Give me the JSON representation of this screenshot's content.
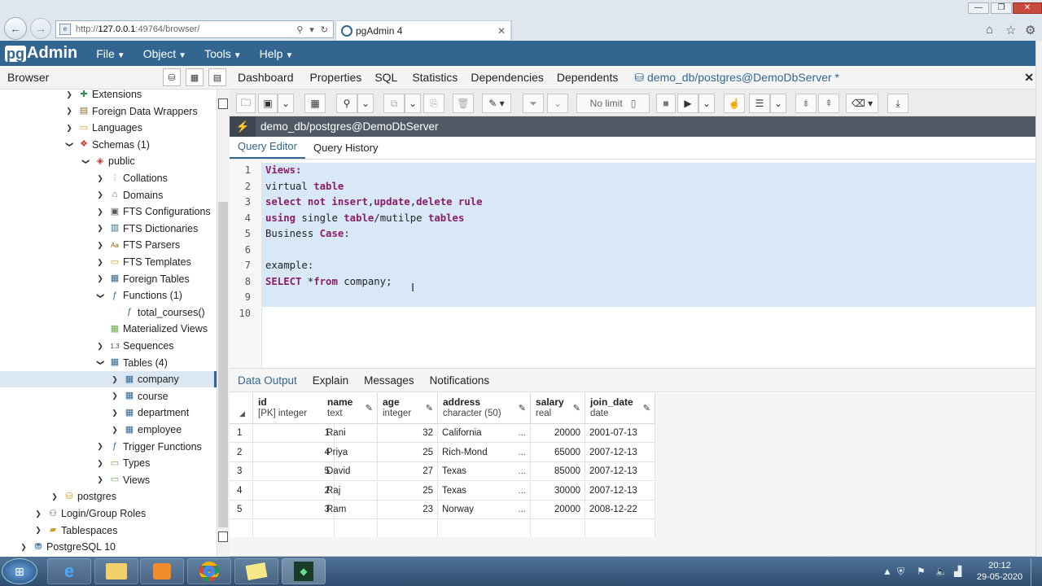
{
  "browser": {
    "url": "http://127.0.0.1:49764/browser/",
    "url_prefix": "http://",
    "url_host": "127.0.0.1",
    "url_rest": ":49764/browser/",
    "tab_title": "pgAdmin 4"
  },
  "app": {
    "logo_pg": "pg",
    "logo_rest": "Admin",
    "menus": [
      "File",
      "Object",
      "Tools",
      "Help"
    ]
  },
  "browser_panel": {
    "title": "Browser"
  },
  "tree": [
    {
      "label": "Extensions",
      "depth": 4,
      "arrow": "›",
      "icon": "puzzle-icon"
    },
    {
      "label": "Foreign Data Wrappers",
      "depth": 4,
      "arrow": "›",
      "icon": "fdw-icon"
    },
    {
      "label": "Languages",
      "depth": 4,
      "arrow": "›",
      "icon": "language-icon"
    },
    {
      "label": "Schemas (1)",
      "depth": 4,
      "arrow": "⌄",
      "icon": "schema-icon"
    },
    {
      "label": "public",
      "depth": 5,
      "arrow": "⌄",
      "icon": "schema-public-icon"
    },
    {
      "label": "Collations",
      "depth": 6,
      "arrow": "›",
      "icon": "collation-icon"
    },
    {
      "label": "Domains",
      "depth": 6,
      "arrow": "›",
      "icon": "domain-icon"
    },
    {
      "label": "FTS Configurations",
      "depth": 6,
      "arrow": "›",
      "icon": "fts-config-icon"
    },
    {
      "label": "FTS Dictionaries",
      "depth": 6,
      "arrow": "›",
      "icon": "fts-dictionary-icon"
    },
    {
      "label": "FTS Parsers",
      "depth": 6,
      "arrow": "›",
      "icon": "fts-parser-icon"
    },
    {
      "label": "FTS Templates",
      "depth": 6,
      "arrow": "›",
      "icon": "fts-template-icon"
    },
    {
      "label": "Foreign Tables",
      "depth": 6,
      "arrow": "›",
      "icon": "foreign-table-icon"
    },
    {
      "label": "Functions (1)",
      "depth": 6,
      "arrow": "⌄",
      "icon": "function-icon"
    },
    {
      "label": "total_courses()",
      "depth": 7,
      "arrow": "",
      "icon": "function-icon"
    },
    {
      "label": "Materialized Views",
      "depth": 6,
      "arrow": "",
      "icon": "materialized-view-icon"
    },
    {
      "label": "Sequences",
      "depth": 6,
      "arrow": "›",
      "icon": "sequence-icon"
    },
    {
      "label": "Tables (4)",
      "depth": 6,
      "arrow": "⌄",
      "icon": "table-icon"
    },
    {
      "label": "company",
      "depth": 7,
      "arrow": "›",
      "icon": "table-icon",
      "selected": true
    },
    {
      "label": "course",
      "depth": 7,
      "arrow": "›",
      "icon": "table-icon"
    },
    {
      "label": "department",
      "depth": 7,
      "arrow": "›",
      "icon": "table-icon"
    },
    {
      "label": "employee",
      "depth": 7,
      "arrow": "›",
      "icon": "table-icon"
    },
    {
      "label": "Trigger Functions",
      "depth": 6,
      "arrow": "›",
      "icon": "trigger-function-icon"
    },
    {
      "label": "Types",
      "depth": 6,
      "arrow": "›",
      "icon": "type-icon"
    },
    {
      "label": "Views",
      "depth": 6,
      "arrow": "›",
      "icon": "view-icon"
    },
    {
      "label": "postgres",
      "depth": 3,
      "arrow": "›",
      "icon": "database-icon"
    },
    {
      "label": "Login/Group Roles",
      "depth": 2,
      "arrow": "›",
      "icon": "roles-icon"
    },
    {
      "label": "Tablespaces",
      "depth": 2,
      "arrow": "›",
      "icon": "tablespace-icon"
    },
    {
      "label": "PostgreSQL 10",
      "depth": 1,
      "arrow": "›",
      "icon": "server-icon"
    }
  ],
  "main_tabs": [
    "Dashboard",
    "Properties",
    "SQL",
    "Statistics",
    "Dependencies",
    "Dependents",
    "demo_db/postgres@DemoDbServer *"
  ],
  "toolbar": {
    "limit": "No limit"
  },
  "connection": {
    "label": "demo_db/postgres@DemoDbServer"
  },
  "query_tabs": [
    "Query Editor",
    "Query History"
  ],
  "editor": {
    "line_numbers": [
      "1",
      "2",
      "3",
      "4",
      "5",
      "6",
      "7",
      "8",
      "9",
      "10"
    ],
    "lines": [
      [
        {
          "t": "Views:",
          "k": true
        }
      ],
      [
        {
          "t": "virtual ",
          "k": false
        },
        {
          "t": "table",
          "k": true
        }
      ],
      [
        {
          "t": "select not insert",
          "k": true
        },
        {
          "t": ",",
          "k": false
        },
        {
          "t": "update",
          "k": true
        },
        {
          "t": ",",
          "k": false
        },
        {
          "t": "delete rule",
          "k": true
        }
      ],
      [
        {
          "t": "using",
          "k": true
        },
        {
          "t": " single ",
          "k": false
        },
        {
          "t": "table",
          "k": true
        },
        {
          "t": "/mutilpe ",
          "k": false
        },
        {
          "t": "tables",
          "k": true
        }
      ],
      [
        {
          "t": "Business ",
          "k": false
        },
        {
          "t": "Case",
          "k": true
        },
        {
          "t": ":",
          "k": false
        }
      ],
      [],
      [
        {
          "t": "example:",
          "k": false
        }
      ],
      [
        {
          "t": "SELECT",
          "k": true
        },
        {
          "t": " *",
          "k": false
        },
        {
          "t": "from",
          "k": true
        },
        {
          "t": " company;",
          "k": false
        }
      ],
      [],
      []
    ]
  },
  "output_tabs": [
    "Data Output",
    "Explain",
    "Messages",
    "Notifications"
  ],
  "grid": {
    "columns": [
      {
        "name": "id",
        "type": "[PK] integer"
      },
      {
        "name": "name",
        "type": "text"
      },
      {
        "name": "age",
        "type": "integer"
      },
      {
        "name": "address",
        "type": "character (50)"
      },
      {
        "name": "salary",
        "type": "real"
      },
      {
        "name": "join_date",
        "type": "date"
      }
    ],
    "rows": [
      {
        "n": "1",
        "cells": [
          "1",
          "Rani",
          "32",
          "California",
          "20000",
          "2001-07-13"
        ]
      },
      {
        "n": "2",
        "cells": [
          "4",
          "Priya",
          "25",
          "Rich-Mond",
          "65000",
          "2007-12-13"
        ]
      },
      {
        "n": "3",
        "cells": [
          "5",
          "David",
          "27",
          "Texas",
          "85000",
          "2007-12-13"
        ]
      },
      {
        "n": "4",
        "cells": [
          "2",
          "Raj",
          "25",
          "Texas",
          "30000",
          "2007-12-13"
        ]
      },
      {
        "n": "5",
        "cells": [
          "3",
          "Ram",
          "23",
          "Norway",
          "20000",
          "2008-12-22"
        ]
      }
    ],
    "ellipsis": "..."
  },
  "taskbar": {
    "time": "20:12",
    "date": "29-05-2020"
  },
  "colors": {
    "brand": "#326690",
    "keyword": "#8b1d68",
    "selection": "#d9e8f7"
  }
}
